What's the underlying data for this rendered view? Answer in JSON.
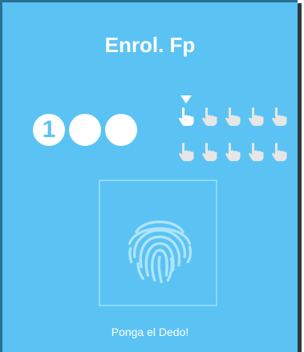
{
  "title": "Enrol. Fp",
  "steps": {
    "current_number": "1",
    "total": 3,
    "current": 1
  },
  "fingers": {
    "rows": 2,
    "per_row": 5,
    "selected_index": 0,
    "icon": "pointing-hand-icon"
  },
  "scan_area": {
    "icon": "fingerprint-icon"
  },
  "prompt": "Ponga el Dedo!",
  "colors": {
    "background": "#5bc3f3",
    "foreground": "#ffffff",
    "finger_inactive": "#e6e6e6",
    "finger_active": "#ffffff",
    "frame": "#8fd8fa",
    "fingerprint": "#aee4fb"
  }
}
